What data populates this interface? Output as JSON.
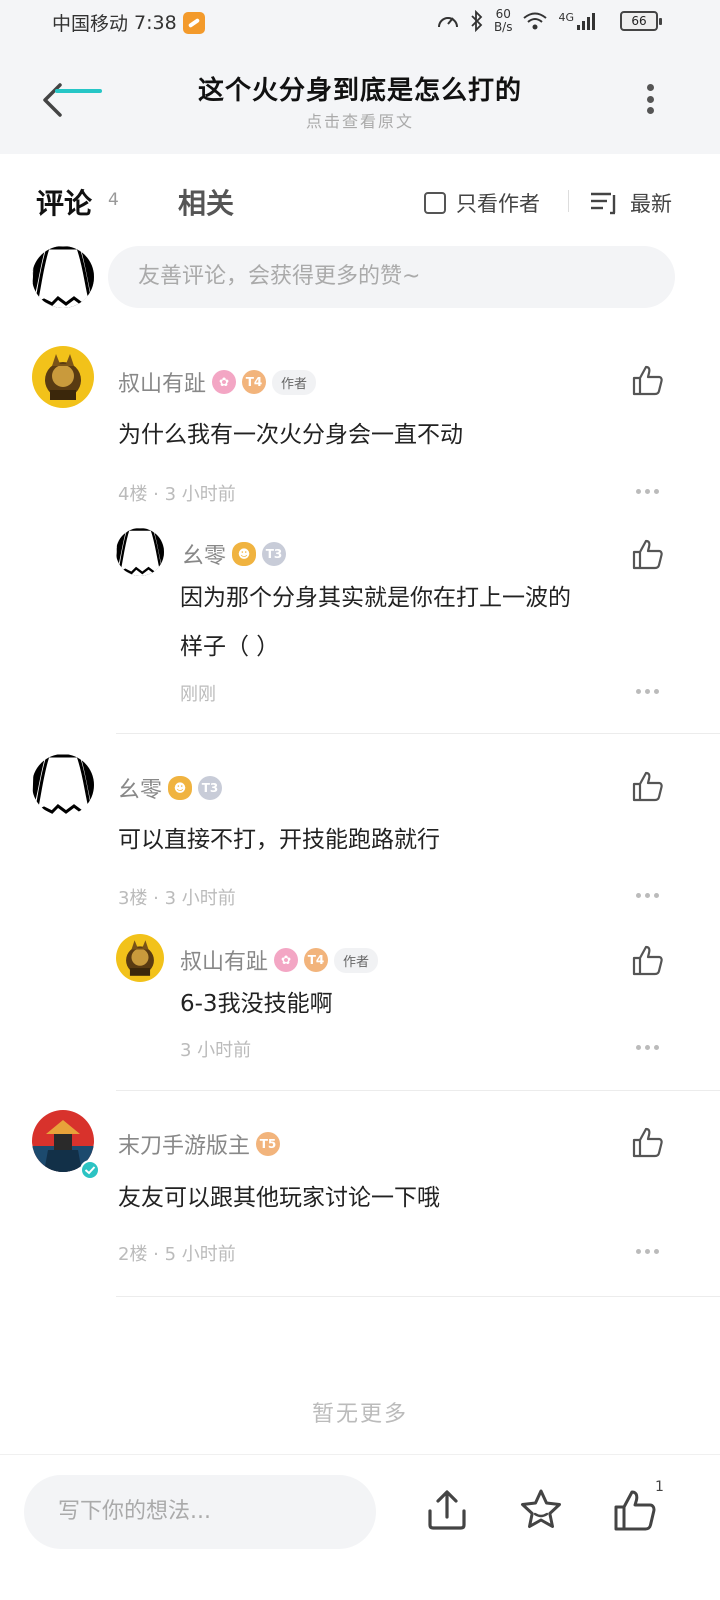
{
  "status_bar": {
    "carrier": "中国移动",
    "time": "7:38",
    "net_speed_value": "60",
    "net_speed_unit": "B/s",
    "network": "4G",
    "battery": "66"
  },
  "header": {
    "title": "这个火分身到底是怎么打的",
    "subtitle": "点击查看原文"
  },
  "tabs": {
    "comments_label": "评论",
    "comments_count": "4",
    "related_label": "相关",
    "only_author_label": "只看作者",
    "sort_label": "最新"
  },
  "compose": {
    "placeholder": "友善评论，会获得更多的赞~"
  },
  "comments": [
    {
      "author": "叔山有趾",
      "author_tag": "作者",
      "level": "T4",
      "text": "为什么我有一次火分身会一直不动",
      "meta": "4楼 · 3 小时前",
      "reply": {
        "author": "幺零",
        "level": "T3",
        "text_line1": "因为那个分身其实就是你在打上一波的",
        "text_line2": "样子（  ）",
        "meta": "刚刚"
      }
    },
    {
      "author": "幺零",
      "level": "T3",
      "text": "可以直接不打，开技能跑路就行",
      "meta": "3楼 · 3 小时前",
      "reply": {
        "author": "叔山有趾",
        "author_tag": "作者",
        "level": "T4",
        "text": "6-3我没技能啊",
        "meta": "3 小时前"
      }
    },
    {
      "author": "末刀手游版主",
      "level": "T5",
      "text": "友友可以跟其他玩家讨论一下哦",
      "meta": "2楼 · 5 小时前"
    }
  ],
  "footer": {
    "no_more": "暂无更多",
    "write_placeholder": "写下你的想法...",
    "like_count": "1"
  }
}
